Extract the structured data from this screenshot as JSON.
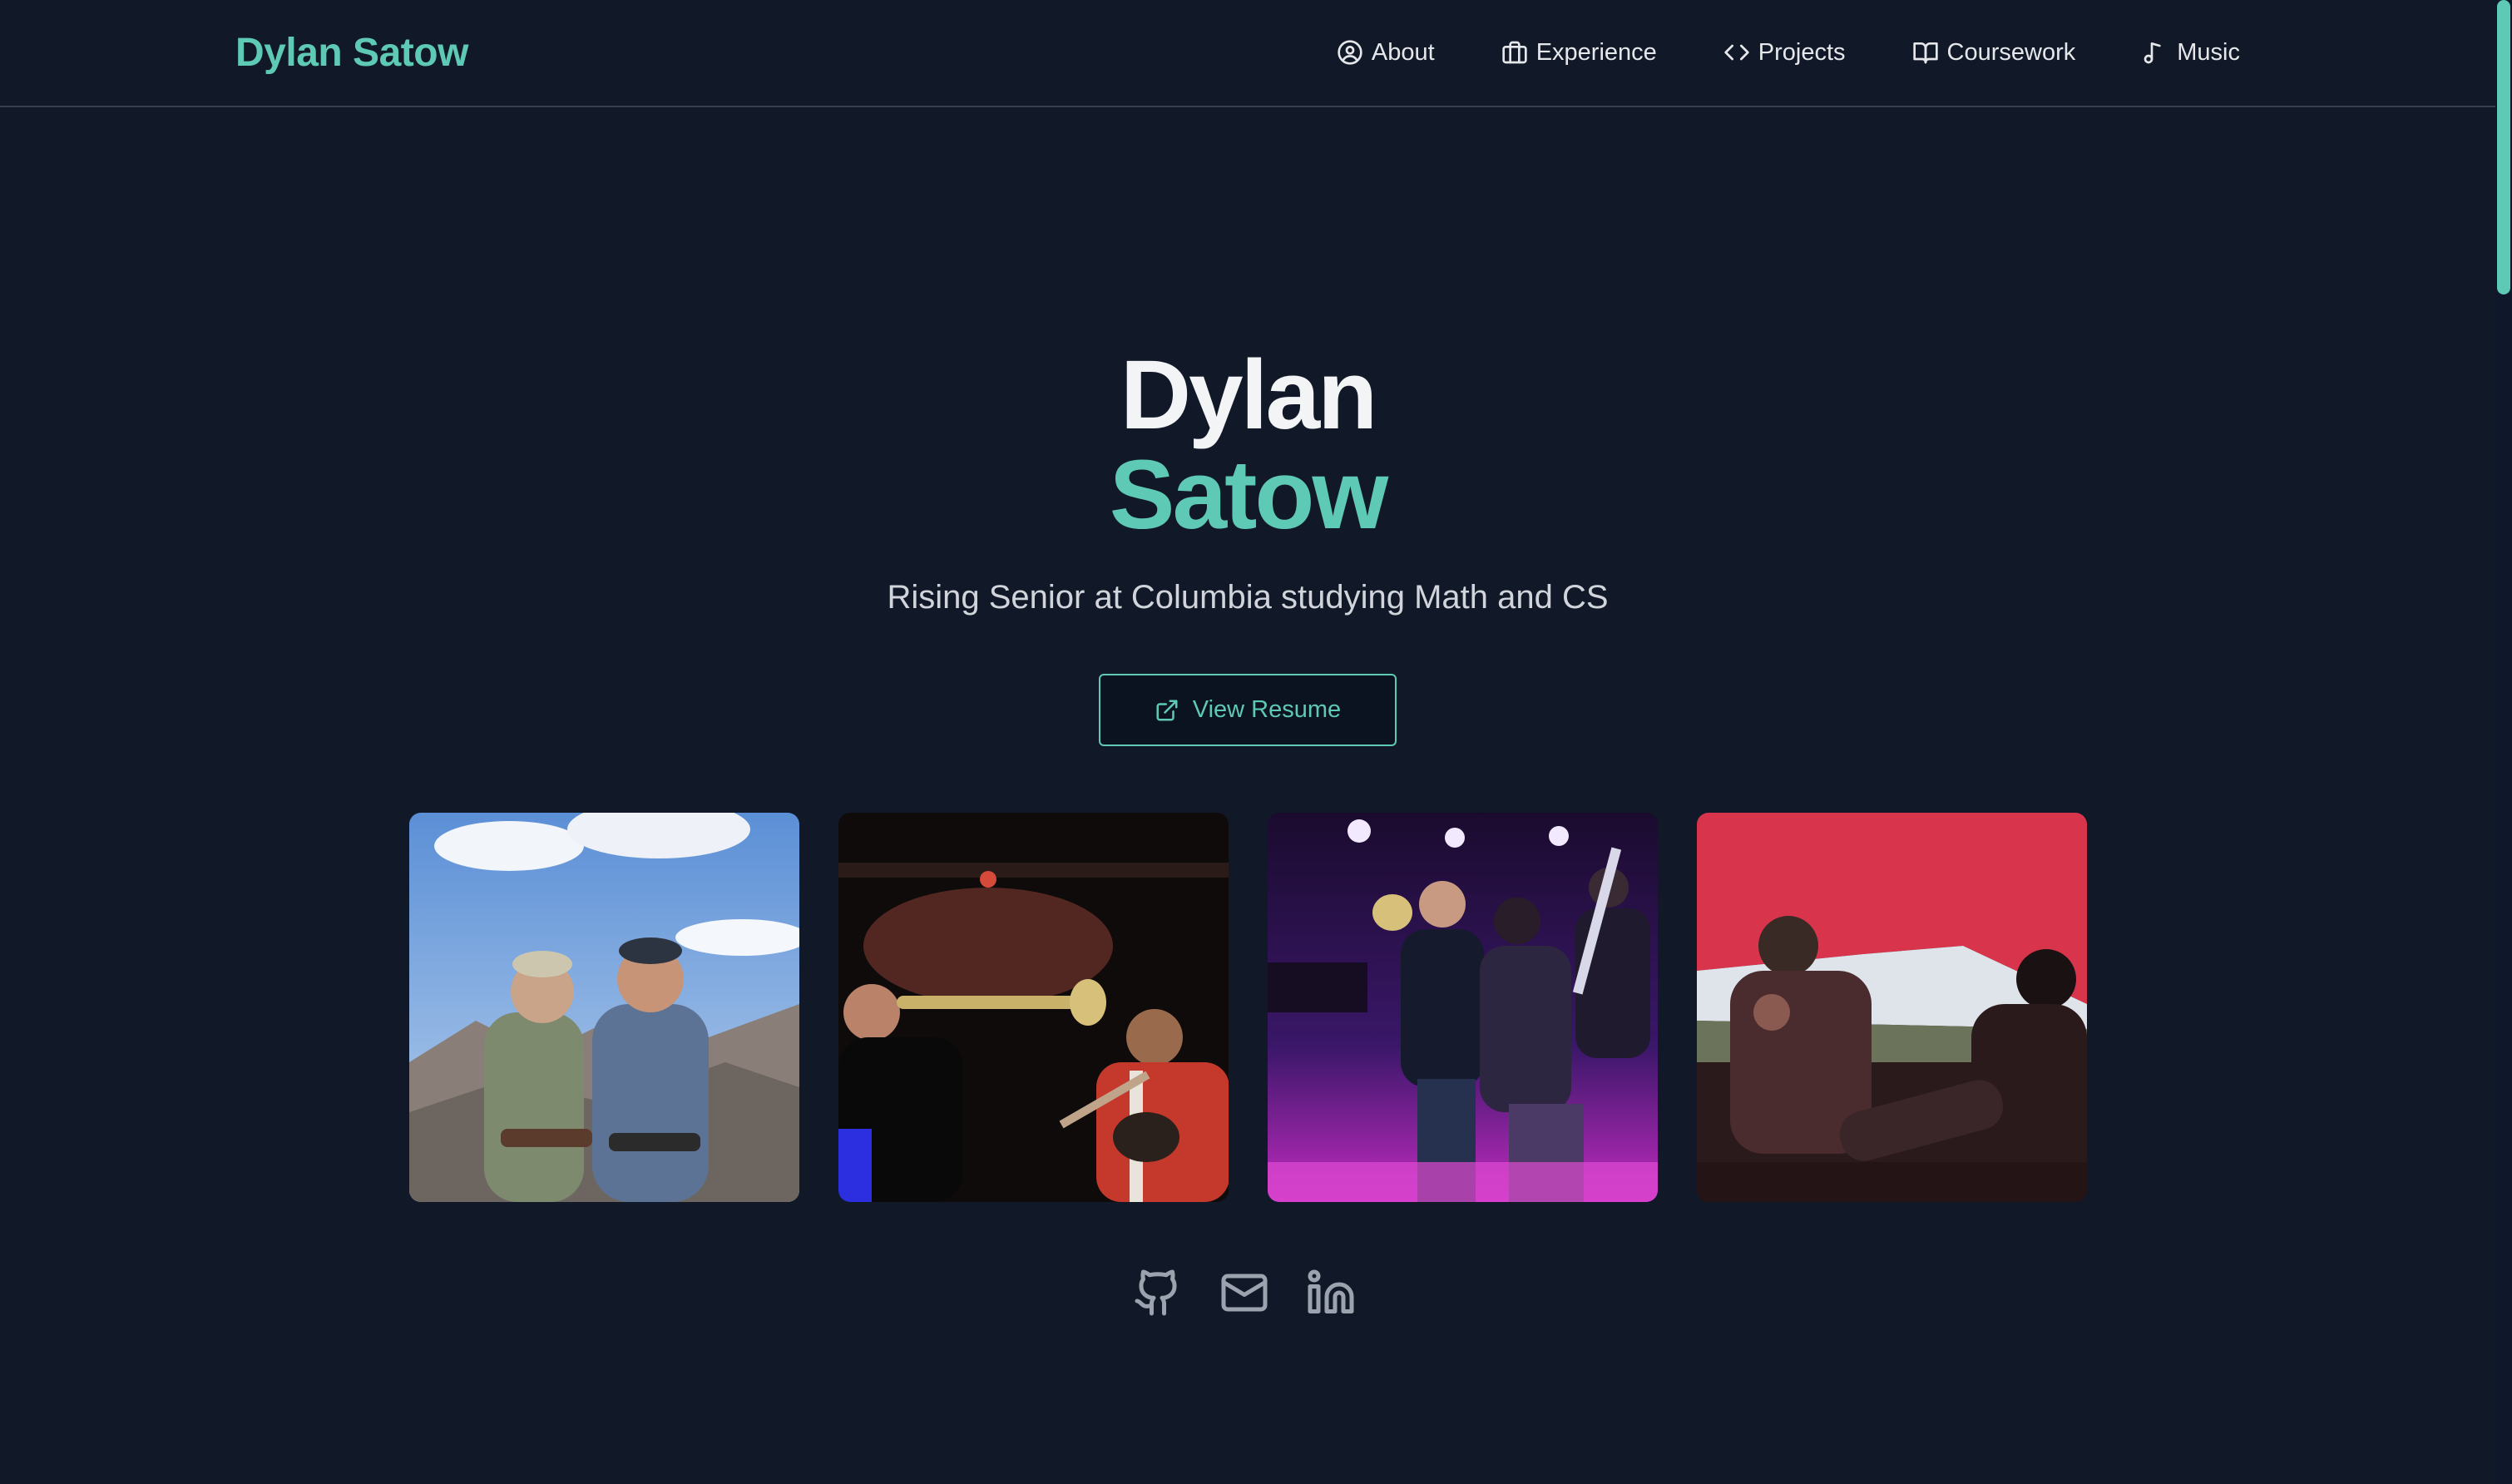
{
  "header": {
    "brand": "Dylan Satow",
    "nav": [
      {
        "label": "About",
        "icon": "user-circle-icon"
      },
      {
        "label": "Experience",
        "icon": "briefcase-icon"
      },
      {
        "label": "Projects",
        "icon": "code-icon"
      },
      {
        "label": "Coursework",
        "icon": "book-open-icon"
      },
      {
        "label": "Music",
        "icon": "music-note-icon"
      }
    ]
  },
  "hero": {
    "first_name": "Dylan",
    "last_name": "Satow",
    "tagline": "Rising Senior at Columbia studying Math and CS",
    "resume_button": {
      "label": "View Resume",
      "icon": "external-link-icon"
    }
  },
  "gallery": [
    {
      "subject": "mountain-summit-photo"
    },
    {
      "subject": "band-trumpet-photo"
    },
    {
      "subject": "band-stage-purple-photo"
    },
    {
      "subject": "tent-red-photo"
    }
  ],
  "social": [
    {
      "icon": "github-icon"
    },
    {
      "icon": "mail-icon"
    },
    {
      "icon": "linkedin-icon"
    }
  ],
  "colors": {
    "background": "#111827",
    "accent": "#5ec9b5",
    "text": "#e5e7eb",
    "muted": "#9ca3af",
    "border": "#374151"
  }
}
